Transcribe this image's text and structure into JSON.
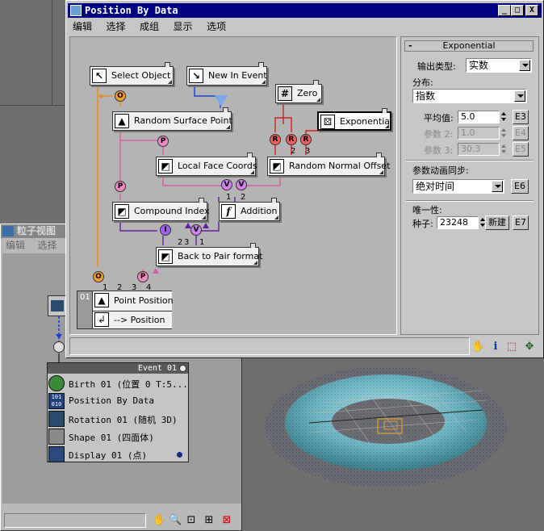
{
  "main_window": {
    "title": "Position By Data",
    "menu": [
      "编辑",
      "选择",
      "成组",
      "显示",
      "选项"
    ],
    "controls": {
      "minimize": "_",
      "maximize": "□",
      "close": "X"
    }
  },
  "graph": {
    "nodes": {
      "select_object": "Select Object",
      "new_in_event": "New In Event",
      "zero": "Zero",
      "exponential": "Exponential",
      "random_surface_point": "Random Surface Point",
      "local_face_coords": "Local Face Coords",
      "random_normal_offset": "Random Normal Offset",
      "compound_index": "Compound Index",
      "addition": "Addition",
      "back_to_pair_format": "Back to Pair format",
      "point_position": "Point Position",
      "to_position": "--> Position"
    },
    "output_number": "01",
    "circle_labels": {
      "o": "O",
      "p": "P",
      "r": "R",
      "v": "V",
      "i": "I"
    },
    "port_numbers": [
      "1",
      "2",
      "3",
      "4"
    ]
  },
  "panel": {
    "title": "Exponential",
    "output_type_label": "输出类型:",
    "output_type_value": "实数",
    "distribution_label": "分布:",
    "distribution_value": "指数",
    "mean_label": "平均值:",
    "mean_value": "5.0",
    "mean_btn": "E3",
    "param2_label": "参数 2:",
    "param2_value": "1.0",
    "param2_btn": "E4",
    "param3_label": "参数 3:",
    "param3_value": "30.3",
    "param3_btn": "E5",
    "sync_label": "参数动画同步:",
    "sync_value": "绝对时间",
    "sync_btn": "E6",
    "unique_label": "唯一性:",
    "seed_label": "种子:",
    "seed_value": "23248",
    "new_btn": "新建",
    "new_btn_id": "E7"
  },
  "particle_view": {
    "title": "粒子视图",
    "menu": [
      "编辑",
      "选择"
    ],
    "event": {
      "name": "Event 01",
      "operators": [
        "Birth 01 (位置 0 T:5...",
        "Position By Data",
        "Rotation 01 (随机 3D)",
        "Shape 01 (四面体)",
        "Display 01 (点)"
      ]
    }
  },
  "colors": {
    "title_bar": "#000080",
    "wire_orange": "#e09020",
    "wire_pink": "#d060a0",
    "wire_red": "#d02020",
    "wire_blue": "#2040d0",
    "wire_purple": "#6020a0",
    "torus": "#6fb8c0",
    "particles": "#1a2a80"
  },
  "icons": {
    "toolbar": [
      "hand-pan-icon",
      "info-icon",
      "region-select-icon",
      "navigator-icon"
    ],
    "pv_toolbar": [
      "hand-pan-icon",
      "zoom-icon",
      "zoom-region-icon",
      "zoom-extents-icon",
      "no-connection-icon"
    ]
  }
}
